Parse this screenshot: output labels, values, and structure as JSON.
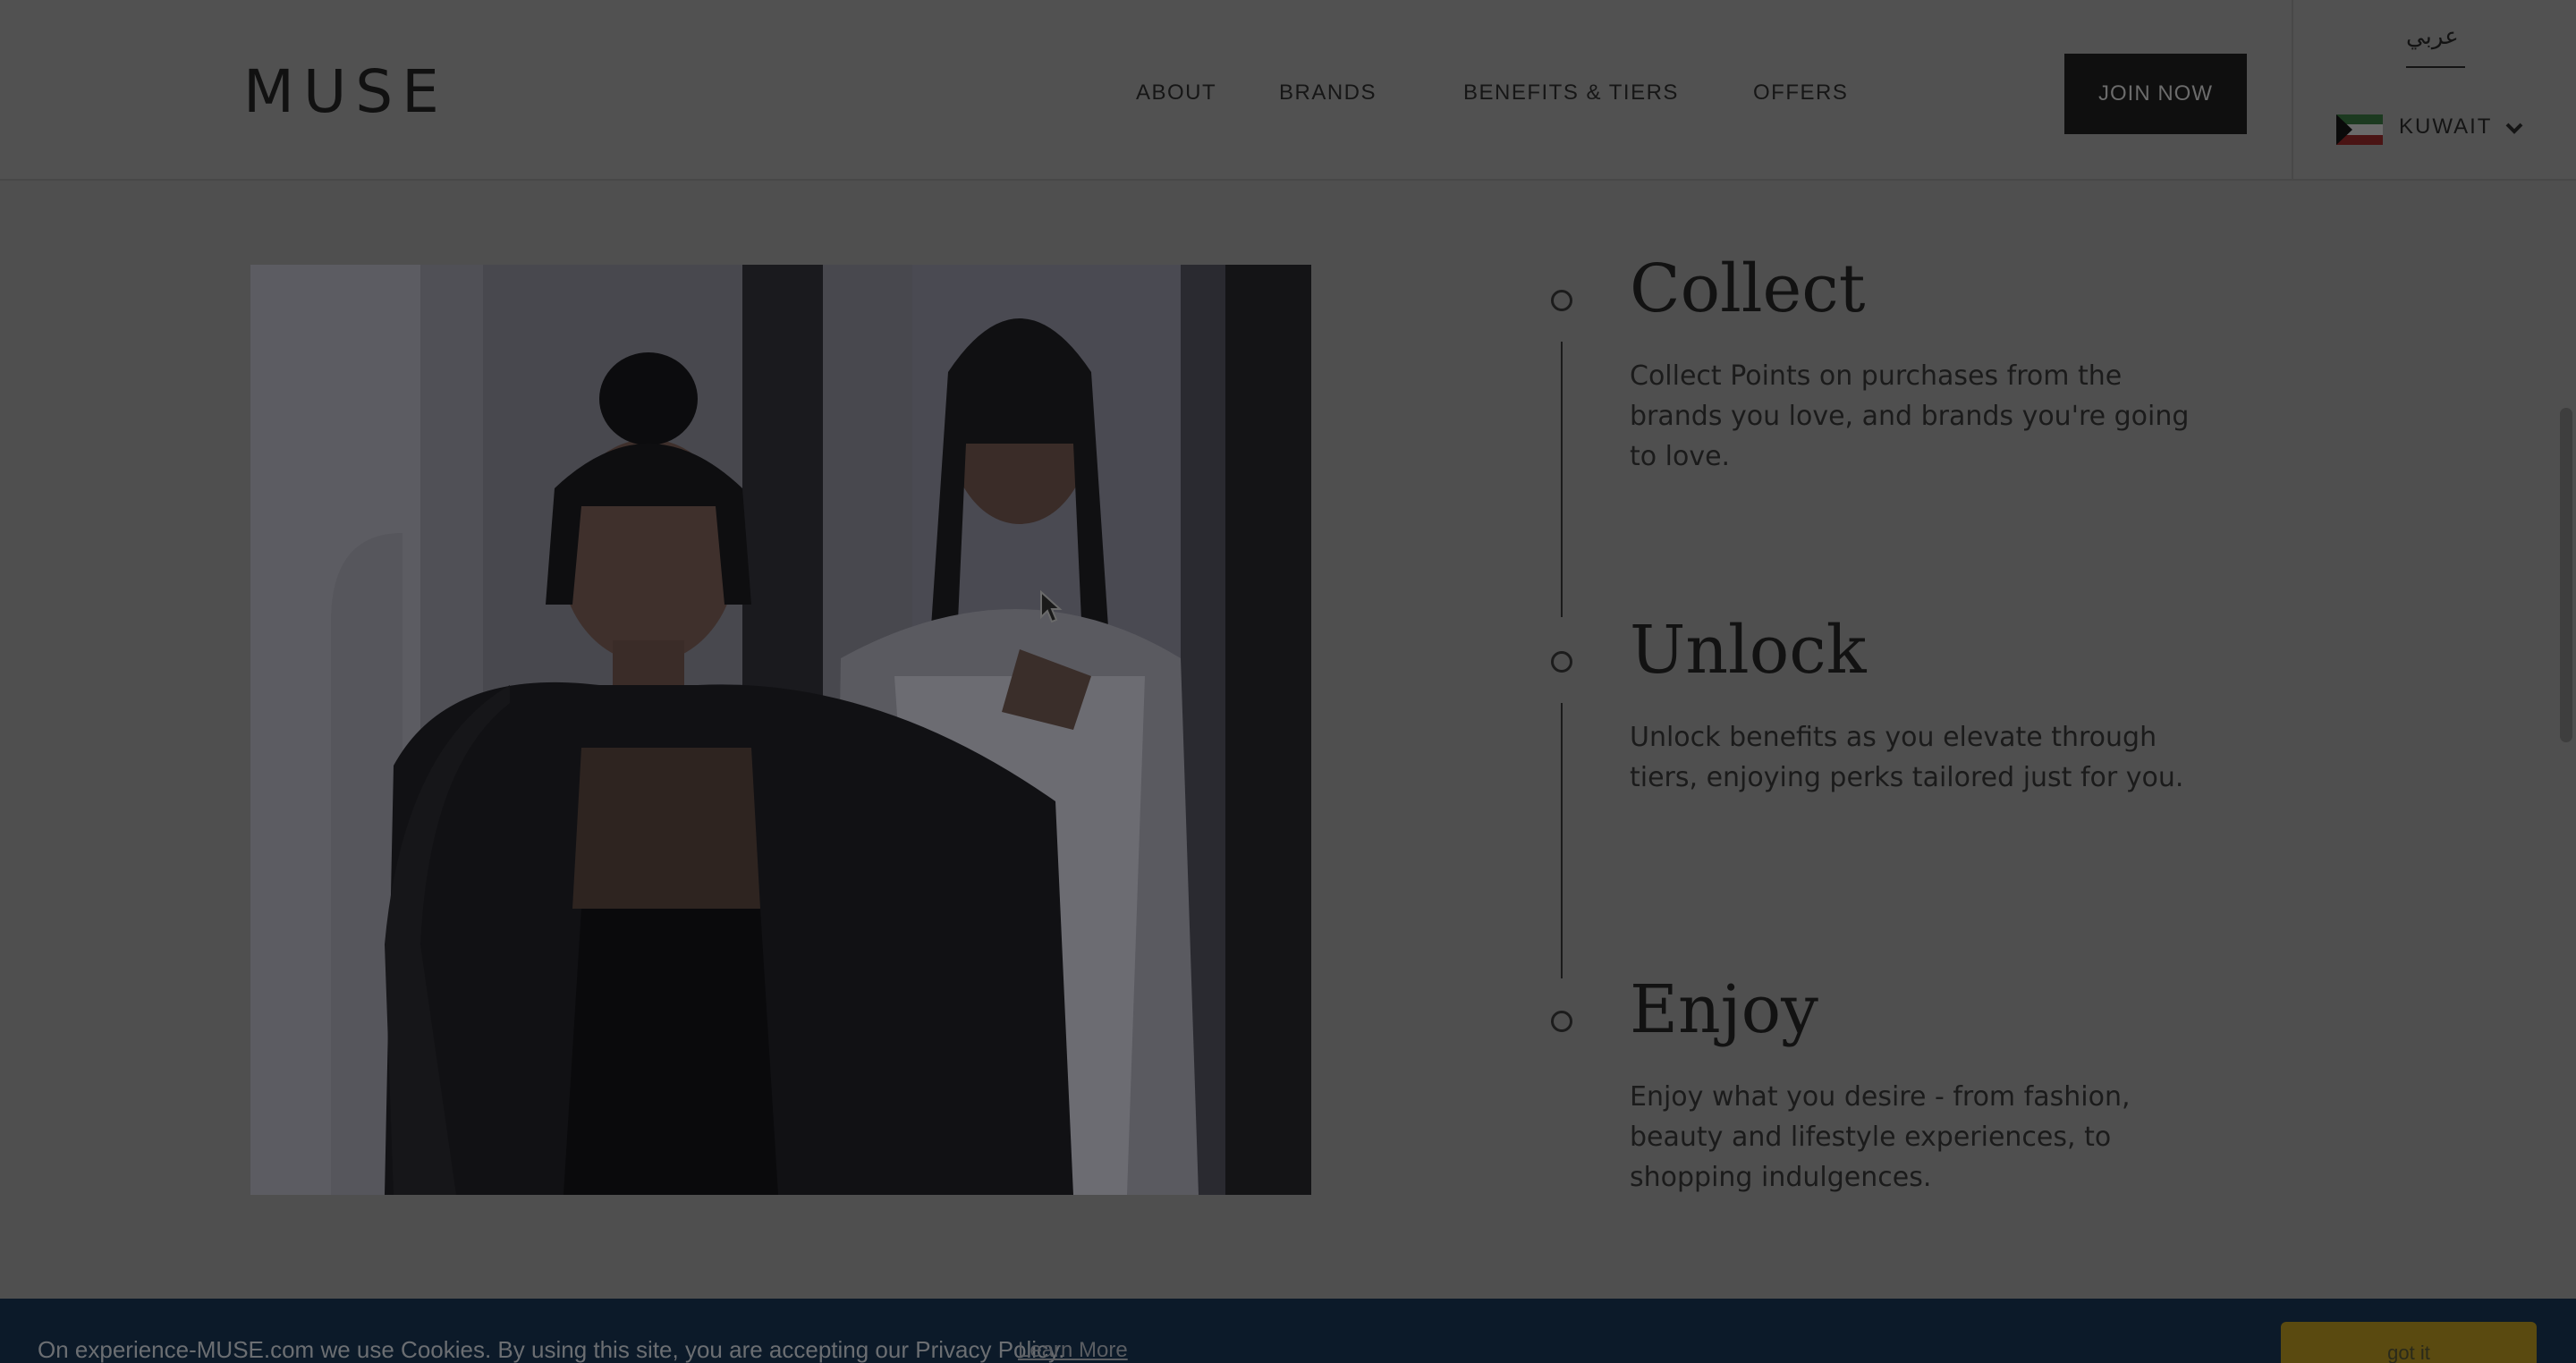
{
  "header": {
    "logo": "MUSE",
    "nav": {
      "about": "ABOUT",
      "brands": "BRANDS",
      "benefits": "BENEFITS & TIERS",
      "offers": "OFFERS"
    },
    "join_label": "JOIN NOW",
    "language_link": "عربي",
    "country": "KUWAIT",
    "flag_icon": "kuwait-flag-icon",
    "dropdown_icon": "chevron-down-icon"
  },
  "steps": [
    {
      "title": "Collect",
      "description": "Collect Points on purchases from the brands you love, and brands you're going to love."
    },
    {
      "title": "Unlock",
      "description": "Unlock benefits as you elevate through tiers, enjoying perks tailored just for you."
    },
    {
      "title": "Enjoy",
      "description": "Enjoy what you desire - from fashion, beauty and lifestyle experiences, to shopping indulgences."
    }
  ],
  "cookie": {
    "text": "On experience-MUSE.com we use Cookies. By using this site, you are accepting our Privacy Policy.",
    "link": "Learn More",
    "button": "got it"
  },
  "colors": {
    "overlay_background": "#4f4f4f",
    "cookie_bar": "#0c1a29",
    "cookie_button": "#5a4a10",
    "join_button": "#0f0f0f"
  }
}
